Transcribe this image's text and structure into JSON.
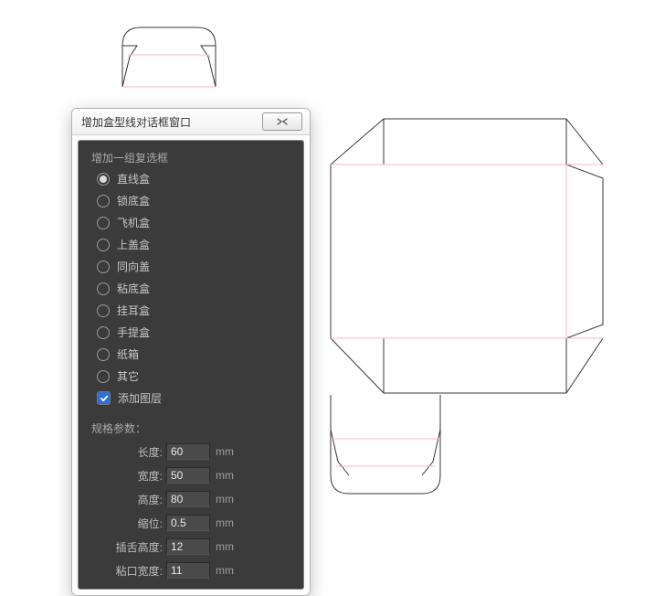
{
  "dialog": {
    "title": "增加盒型线对话框窗口",
    "group_label": "增加一组复选框",
    "options": [
      "直线盒",
      "锁底盒",
      "飞机盒",
      "上盖盒",
      "同向盖",
      "粘底盒",
      "挂耳盒",
      "手提盒",
      "纸箱",
      "其它"
    ],
    "selected_index": 0,
    "add_layer_label": "添加图层",
    "add_layer_checked": true,
    "params_label": "规格参数：",
    "params": [
      {
        "label": "长度:",
        "value": "60",
        "unit": "mm"
      },
      {
        "label": "宽度:",
        "value": "50",
        "unit": "mm"
      },
      {
        "label": "高度:",
        "value": "80",
        "unit": "mm"
      },
      {
        "label": "缩位:",
        "value": "0.5",
        "unit": "mm"
      },
      {
        "label": "插舌高度:",
        "value": "12",
        "unit": "mm"
      },
      {
        "label": "粘口宽度:",
        "value": "11",
        "unit": "mm"
      }
    ]
  }
}
